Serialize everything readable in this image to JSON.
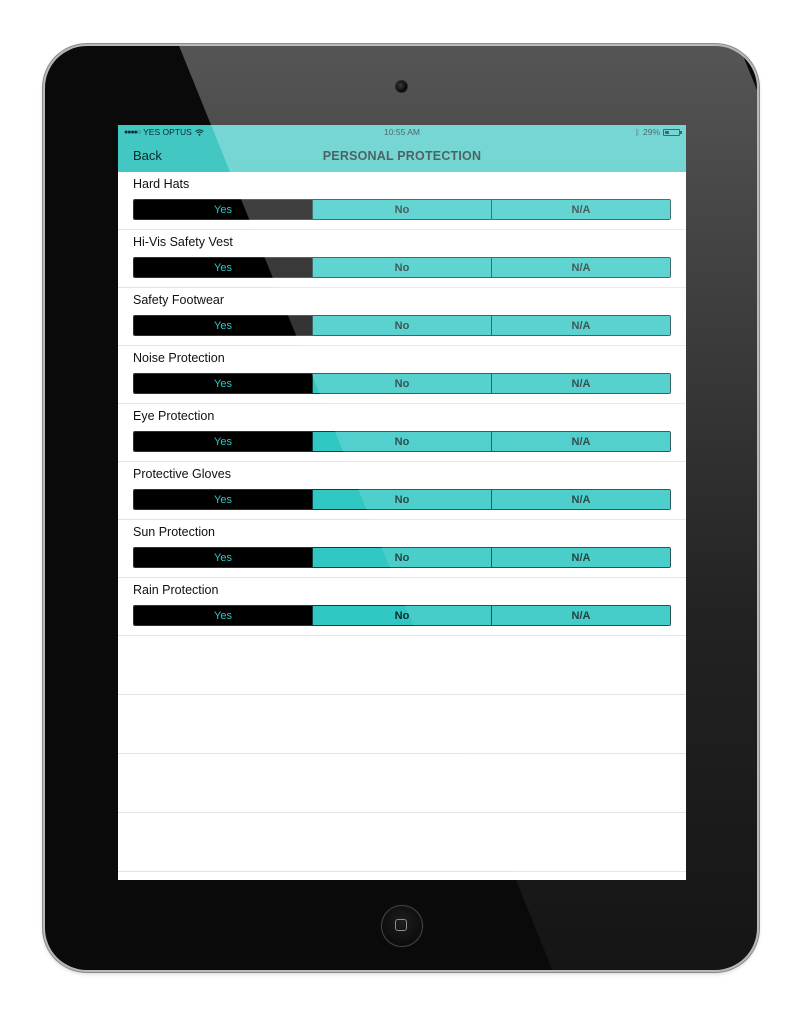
{
  "status_bar": {
    "carrier": "YES OPTUS",
    "signal": "●●●●○",
    "wifi_icon": "wifi-icon",
    "time": "10:55 AM",
    "bluetooth_icon": "bluetooth-icon",
    "battery": "29%"
  },
  "nav": {
    "back_label": "Back",
    "title": "PERSONAL PROTECTION"
  },
  "colors": {
    "accent": "#31c7c3",
    "selected_bg": "#000000"
  },
  "options": [
    "Yes",
    "No",
    "N/A"
  ],
  "items": [
    {
      "label": "Hard Hats",
      "selected": "Yes"
    },
    {
      "label": "Hi-Vis Safety Vest",
      "selected": "Yes"
    },
    {
      "label": "Safety Footwear",
      "selected": "Yes"
    },
    {
      "label": "Noise Protection",
      "selected": "Yes"
    },
    {
      "label": "Eye Protection",
      "selected": "Yes"
    },
    {
      "label": "Protective Gloves",
      "selected": "Yes"
    },
    {
      "label": "Sun Protection",
      "selected": "Yes"
    },
    {
      "label": "Rain Protection",
      "selected": "Yes"
    }
  ]
}
